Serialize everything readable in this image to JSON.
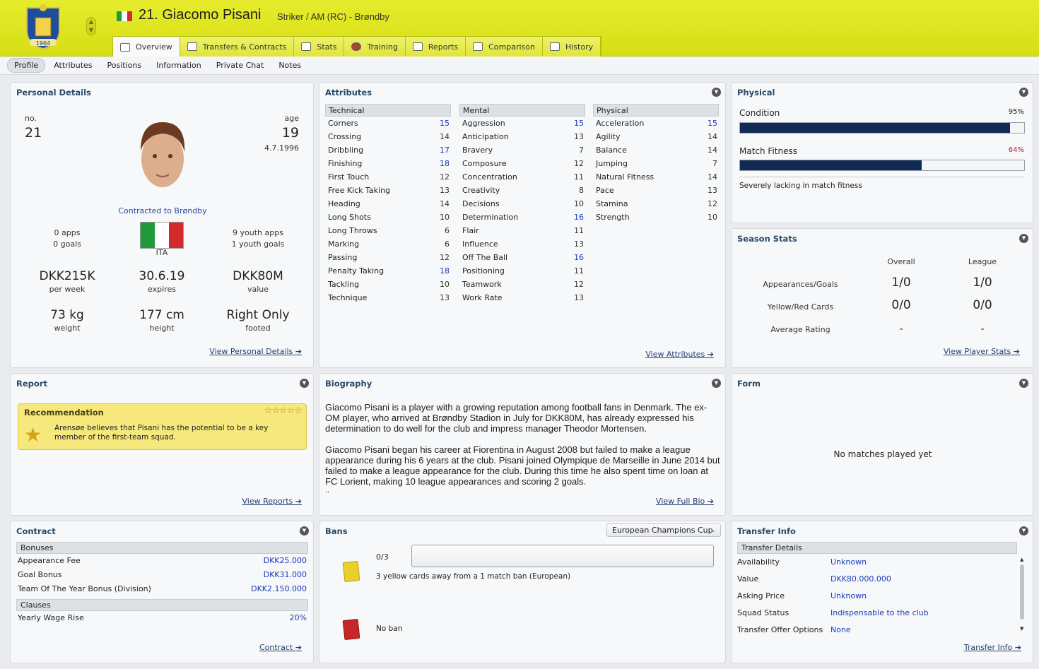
{
  "header": {
    "number_name": "21. Giacomo Pisani",
    "subtitle": "Striker / AM (RC) - Brøndby",
    "crest_year": "1964"
  },
  "tabs": [
    {
      "label": "Overview",
      "active": true,
      "icon": "overview-icon"
    },
    {
      "label": "Transfers & Contracts",
      "icon": "contract-icon"
    },
    {
      "label": "Stats",
      "icon": "stats-icon"
    },
    {
      "label": "Training",
      "icon": "training-icon"
    },
    {
      "label": "Reports",
      "icon": "reports-icon"
    },
    {
      "label": "Comparison",
      "icon": "comparison-icon"
    },
    {
      "label": "History",
      "icon": "history-icon"
    }
  ],
  "subnav": [
    "Profile",
    "Attributes",
    "Positions",
    "Information",
    "Private Chat",
    "Notes"
  ],
  "personal": {
    "title": "Personal Details",
    "no_label": "no.",
    "no": "21",
    "age_label": "age",
    "age": "19",
    "dob": "4.7.1996",
    "contract_status": "Contracted to Brøndby",
    "apps": "0 apps",
    "goals": "0 goals",
    "nation": "ITA",
    "youth_apps": "9 youth apps",
    "youth_goals": "1 youth goals",
    "wage": "DKK215K",
    "wage_label": "per week",
    "expires": "30.6.19",
    "expires_label": "expires",
    "value": "DKK80M",
    "value_label": "value",
    "weight": "73 kg",
    "weight_label": "weight",
    "height": "177 cm",
    "height_label": "height",
    "foot": "Right Only",
    "foot_label": "footed",
    "link": "View Personal Details"
  },
  "attributes": {
    "title": "Attributes",
    "link": "View Attributes",
    "technical": {
      "label": "Technical",
      "rows": [
        [
          "Corners",
          "15"
        ],
        [
          "Crossing",
          "14"
        ],
        [
          "Dribbling",
          "17"
        ],
        [
          "Finishing",
          "18"
        ],
        [
          "First Touch",
          "12"
        ],
        [
          "Free Kick Taking",
          "13"
        ],
        [
          "Heading",
          "14"
        ],
        [
          "Long Shots",
          "10"
        ],
        [
          "Long Throws",
          "6"
        ],
        [
          "Marking",
          "6"
        ],
        [
          "Passing",
          "12"
        ],
        [
          "Penalty Taking",
          "18"
        ],
        [
          "Tackling",
          "10"
        ],
        [
          "Technique",
          "13"
        ]
      ]
    },
    "mental": {
      "label": "Mental",
      "rows": [
        [
          "Aggression",
          "15"
        ],
        [
          "Anticipation",
          "13"
        ],
        [
          "Bravery",
          "7"
        ],
        [
          "Composure",
          "12"
        ],
        [
          "Concentration",
          "11"
        ],
        [
          "Creativity",
          "8"
        ],
        [
          "Decisions",
          "10"
        ],
        [
          "Determination",
          "16"
        ],
        [
          "Flair",
          "11"
        ],
        [
          "Influence",
          "13"
        ],
        [
          "Off The Ball",
          "16"
        ],
        [
          "Positioning",
          "11"
        ],
        [
          "Teamwork",
          "12"
        ],
        [
          "Work Rate",
          "13"
        ]
      ]
    },
    "physical": {
      "label": "Physical",
      "rows": [
        [
          "Acceleration",
          "15"
        ],
        [
          "Agility",
          "14"
        ],
        [
          "Balance",
          "14"
        ],
        [
          "Jumping",
          "7"
        ],
        [
          "Natural Fitness",
          "14"
        ],
        [
          "Pace",
          "13"
        ],
        [
          "Stamina",
          "12"
        ],
        [
          "Strength",
          "10"
        ]
      ]
    }
  },
  "physical": {
    "title": "Physical",
    "condition_label": "Condition",
    "condition": "95%",
    "condition_value": 0.95,
    "fitness_label": "Match Fitness",
    "fitness": "64%",
    "fitness_value": 0.64,
    "fitness_color": "#b0222a",
    "note": "Severely lacking in match fitness"
  },
  "season": {
    "title": "Season Stats",
    "col1": "Overall",
    "col2": "League",
    "r1": "Appearances/Goals",
    "r1a": "1/0",
    "r1b": "1/0",
    "r2": "Yellow/Red Cards",
    "r2a": "0/0",
    "r2b": "0/0",
    "r3": "Average Rating",
    "r3a": "-",
    "r3b": "-",
    "link": "View Player Stats"
  },
  "report": {
    "title": "Report",
    "rec_title": "Recommendation",
    "text": "Arensøe believes that Pisani has the potential to be a key member of the first-team squad.",
    "link": "View Reports"
  },
  "bio": {
    "title": "Biography",
    "p1": "Giacomo Pisani is a player with a growing reputation among football fans in Denmark. The ex-OM player, who arrived at Brøndby Stadion in July for DKK80M, has already expressed his determination to do well for the club and impress manager Theodor Mortensen.",
    "p2": "Giacomo Pisani began his career at Fiorentina in August 2008 but failed to make a league appearance during his 6 years at the club. Pisani joined Olympique de Marseille in June 2014 but failed to make a league appearance for the club. During this time he also spent time on loan at FC Lorient, making 10 league appearances and scoring 2 goals.",
    "more": "..",
    "link": "View Full Bio"
  },
  "form": {
    "title": "Form",
    "empty": "No matches played yet"
  },
  "contract": {
    "title": "Contract",
    "bonuses": "Bonuses",
    "rows": [
      [
        "Appearance Fee",
        "DKK25.000"
      ],
      [
        "Goal Bonus",
        "DKK31.000"
      ],
      [
        "Team Of The Year Bonus (Division)",
        "DKK2.150.000"
      ]
    ],
    "clauses": "Clauses",
    "clause_rows": [
      [
        "Yearly Wage Rise",
        "20%"
      ]
    ],
    "link": "Contract"
  },
  "bans": {
    "title": "Bans",
    "competition": "European Champions Cup",
    "yellow_count": "0/3",
    "yellow_progress": 0,
    "yellow_text": "3 yellow cards away from a 1 match ban (European)",
    "red_text": "No ban"
  },
  "transfer": {
    "title": "Transfer Info",
    "section": "Transfer Details",
    "rows": [
      [
        "Availability",
        "Unknown"
      ],
      [
        "Value",
        "DKK80.000.000"
      ],
      [
        "Asking Price",
        "Unknown"
      ],
      [
        "Squad Status",
        "Indispensable to the club"
      ],
      [
        "Transfer Offer Options",
        "None"
      ]
    ],
    "link": "Transfer Info"
  }
}
